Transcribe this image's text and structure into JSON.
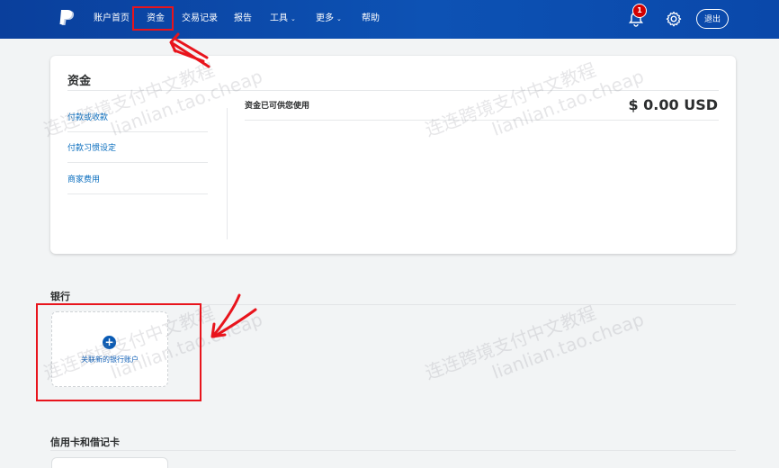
{
  "nav": {
    "items": [
      {
        "label": "账户首页",
        "caret": ""
      },
      {
        "label": "资金",
        "caret": ""
      },
      {
        "label": "交易记录",
        "caret": ""
      },
      {
        "label": "报告",
        "caret": ""
      },
      {
        "label": "工具",
        "caret": "⌄"
      },
      {
        "label": "更多",
        "caret": "⌄"
      },
      {
        "label": "帮助",
        "caret": ""
      }
    ],
    "notification_count": "1",
    "logout_label": "退出"
  },
  "funds": {
    "title": "资金",
    "side_links": [
      "付款或收款",
      "付款习惯设定",
      "商家费用"
    ],
    "available_label": "资金已可供您使用",
    "available_amount": "$ 0.00 USD"
  },
  "bank": {
    "title": "银行",
    "link_new_label": "关联新的银行账户",
    "plus": "+"
  },
  "cards": {
    "title": "信用卡和借记卡"
  },
  "watermarks": [
    {
      "cn": "连连跨境支付中文教程",
      "en": "lianlian.tao.cheap"
    },
    {
      "cn": "连连跨境支付中文教程",
      "en": "lianlian.tao.cheap"
    },
    {
      "cn": "连连跨境支付中文教程",
      "en": "lianlian.tao.cheap"
    },
    {
      "cn": "连连跨境支付中文教程",
      "en": "lianlian.tao.cheap"
    }
  ],
  "colors": {
    "nav_bg": "#0d52b4",
    "link": "#0a6ebf",
    "annotation_red": "#e8141c",
    "badge_red": "#d20000"
  }
}
